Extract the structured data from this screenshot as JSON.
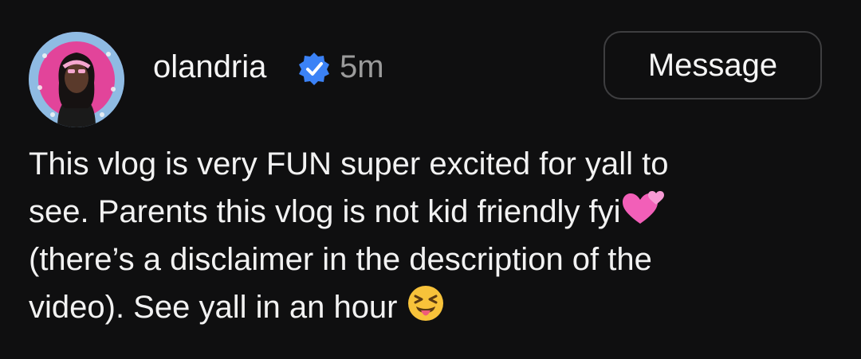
{
  "post": {
    "author": {
      "username": "olandria",
      "verified": true,
      "time": "5m"
    },
    "action_button": "Message",
    "text_lines": [
      "This vlog is very FUN super excited for yall to",
      "see. Parents this vlog is not kid friendly fyi",
      "(there’s a disclaimer in the description of the",
      "video). See yall in an hour"
    ],
    "emojis": [
      "two-hearts-emoji",
      "squinting-tongue-face-emoji"
    ],
    "icons": [
      "avatar",
      "verified-badge-icon"
    ],
    "colors": {
      "background": "#0f0f10",
      "verified_badge": "#3b82f6",
      "timestamp": "#9b9b9b",
      "button_border": "#3e3e40"
    }
  }
}
